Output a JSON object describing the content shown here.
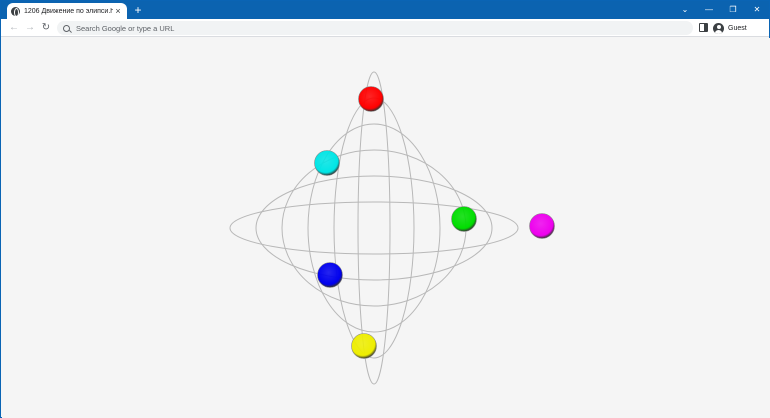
{
  "browser": {
    "tab": {
      "title": "1206 Движение по элипси.html",
      "close_glyph": "×",
      "favicon_icon": "globe-icon"
    },
    "new_tab_glyph": "+",
    "window_controls": {
      "tab_search": "⌄",
      "minimize": "—",
      "restore": "❐",
      "close": "✕"
    },
    "nav": {
      "back": "←",
      "forward": "→",
      "reload": "↻"
    },
    "omnibox": {
      "placeholder": "Search Google or type a URL",
      "icon": "search-icon"
    },
    "side_panel_icon": "side-panel-icon",
    "profile": {
      "label": "Guest",
      "icon": "avatar-icon"
    }
  },
  "page": {
    "background": "#f5f5f5",
    "orbit_color": "#b8b8b8",
    "balls": [
      {
        "name": "red",
        "color": "#ff0000"
      },
      {
        "name": "cyan",
        "color": "#00e5e5"
      },
      {
        "name": "green",
        "color": "#00dd00"
      },
      {
        "name": "magenta",
        "color": "#ee00ee"
      },
      {
        "name": "blue",
        "color": "#0000ee"
      },
      {
        "name": "yellow",
        "color": "#eeee00"
      }
    ]
  }
}
